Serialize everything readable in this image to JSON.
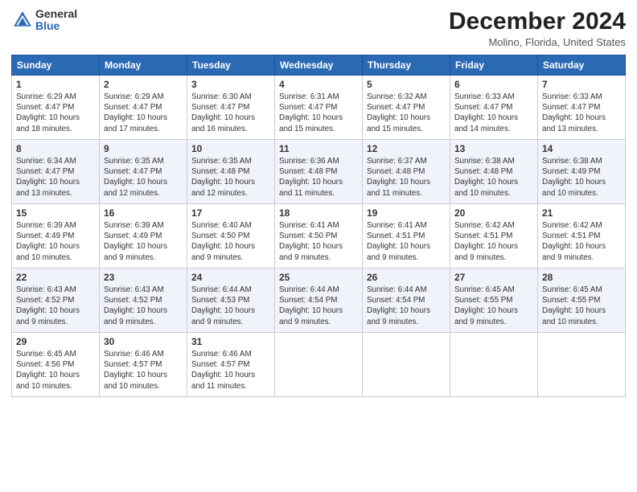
{
  "header": {
    "logo_general": "General",
    "logo_blue": "Blue",
    "title": "December 2024",
    "location": "Molino, Florida, United States"
  },
  "weekdays": [
    "Sunday",
    "Monday",
    "Tuesday",
    "Wednesday",
    "Thursday",
    "Friday",
    "Saturday"
  ],
  "weeks": [
    [
      {
        "day": "1",
        "sunrise": "6:29 AM",
        "sunset": "4:47 PM",
        "daylight": "10 hours and 18 minutes."
      },
      {
        "day": "2",
        "sunrise": "6:29 AM",
        "sunset": "4:47 PM",
        "daylight": "10 hours and 17 minutes."
      },
      {
        "day": "3",
        "sunrise": "6:30 AM",
        "sunset": "4:47 PM",
        "daylight": "10 hours and 16 minutes."
      },
      {
        "day": "4",
        "sunrise": "6:31 AM",
        "sunset": "4:47 PM",
        "daylight": "10 hours and 15 minutes."
      },
      {
        "day": "5",
        "sunrise": "6:32 AM",
        "sunset": "4:47 PM",
        "daylight": "10 hours and 15 minutes."
      },
      {
        "day": "6",
        "sunrise": "6:33 AM",
        "sunset": "4:47 PM",
        "daylight": "10 hours and 14 minutes."
      },
      {
        "day": "7",
        "sunrise": "6:33 AM",
        "sunset": "4:47 PM",
        "daylight": "10 hours and 13 minutes."
      }
    ],
    [
      {
        "day": "8",
        "sunrise": "6:34 AM",
        "sunset": "4:47 PM",
        "daylight": "10 hours and 13 minutes."
      },
      {
        "day": "9",
        "sunrise": "6:35 AM",
        "sunset": "4:47 PM",
        "daylight": "10 hours and 12 minutes."
      },
      {
        "day": "10",
        "sunrise": "6:35 AM",
        "sunset": "4:48 PM",
        "daylight": "10 hours and 12 minutes."
      },
      {
        "day": "11",
        "sunrise": "6:36 AM",
        "sunset": "4:48 PM",
        "daylight": "10 hours and 11 minutes."
      },
      {
        "day": "12",
        "sunrise": "6:37 AM",
        "sunset": "4:48 PM",
        "daylight": "10 hours and 11 minutes."
      },
      {
        "day": "13",
        "sunrise": "6:38 AM",
        "sunset": "4:48 PM",
        "daylight": "10 hours and 10 minutes."
      },
      {
        "day": "14",
        "sunrise": "6:38 AM",
        "sunset": "4:49 PM",
        "daylight": "10 hours and 10 minutes."
      }
    ],
    [
      {
        "day": "15",
        "sunrise": "6:39 AM",
        "sunset": "4:49 PM",
        "daylight": "10 hours and 10 minutes."
      },
      {
        "day": "16",
        "sunrise": "6:39 AM",
        "sunset": "4:49 PM",
        "daylight": "10 hours and 9 minutes."
      },
      {
        "day": "17",
        "sunrise": "6:40 AM",
        "sunset": "4:50 PM",
        "daylight": "10 hours and 9 minutes."
      },
      {
        "day": "18",
        "sunrise": "6:41 AM",
        "sunset": "4:50 PM",
        "daylight": "10 hours and 9 minutes."
      },
      {
        "day": "19",
        "sunrise": "6:41 AM",
        "sunset": "4:51 PM",
        "daylight": "10 hours and 9 minutes."
      },
      {
        "day": "20",
        "sunrise": "6:42 AM",
        "sunset": "4:51 PM",
        "daylight": "10 hours and 9 minutes."
      },
      {
        "day": "21",
        "sunrise": "6:42 AM",
        "sunset": "4:51 PM",
        "daylight": "10 hours and 9 minutes."
      }
    ],
    [
      {
        "day": "22",
        "sunrise": "6:43 AM",
        "sunset": "4:52 PM",
        "daylight": "10 hours and 9 minutes."
      },
      {
        "day": "23",
        "sunrise": "6:43 AM",
        "sunset": "4:52 PM",
        "daylight": "10 hours and 9 minutes."
      },
      {
        "day": "24",
        "sunrise": "6:44 AM",
        "sunset": "4:53 PM",
        "daylight": "10 hours and 9 minutes."
      },
      {
        "day": "25",
        "sunrise": "6:44 AM",
        "sunset": "4:54 PM",
        "daylight": "10 hours and 9 minutes."
      },
      {
        "day": "26",
        "sunrise": "6:44 AM",
        "sunset": "4:54 PM",
        "daylight": "10 hours and 9 minutes."
      },
      {
        "day": "27",
        "sunrise": "6:45 AM",
        "sunset": "4:55 PM",
        "daylight": "10 hours and 9 minutes."
      },
      {
        "day": "28",
        "sunrise": "6:45 AM",
        "sunset": "4:55 PM",
        "daylight": "10 hours and 10 minutes."
      }
    ],
    [
      {
        "day": "29",
        "sunrise": "6:45 AM",
        "sunset": "4:56 PM",
        "daylight": "10 hours and 10 minutes."
      },
      {
        "day": "30",
        "sunrise": "6:46 AM",
        "sunset": "4:57 PM",
        "daylight": "10 hours and 10 minutes."
      },
      {
        "day": "31",
        "sunrise": "6:46 AM",
        "sunset": "4:57 PM",
        "daylight": "10 hours and 11 minutes."
      },
      null,
      null,
      null,
      null
    ]
  ]
}
